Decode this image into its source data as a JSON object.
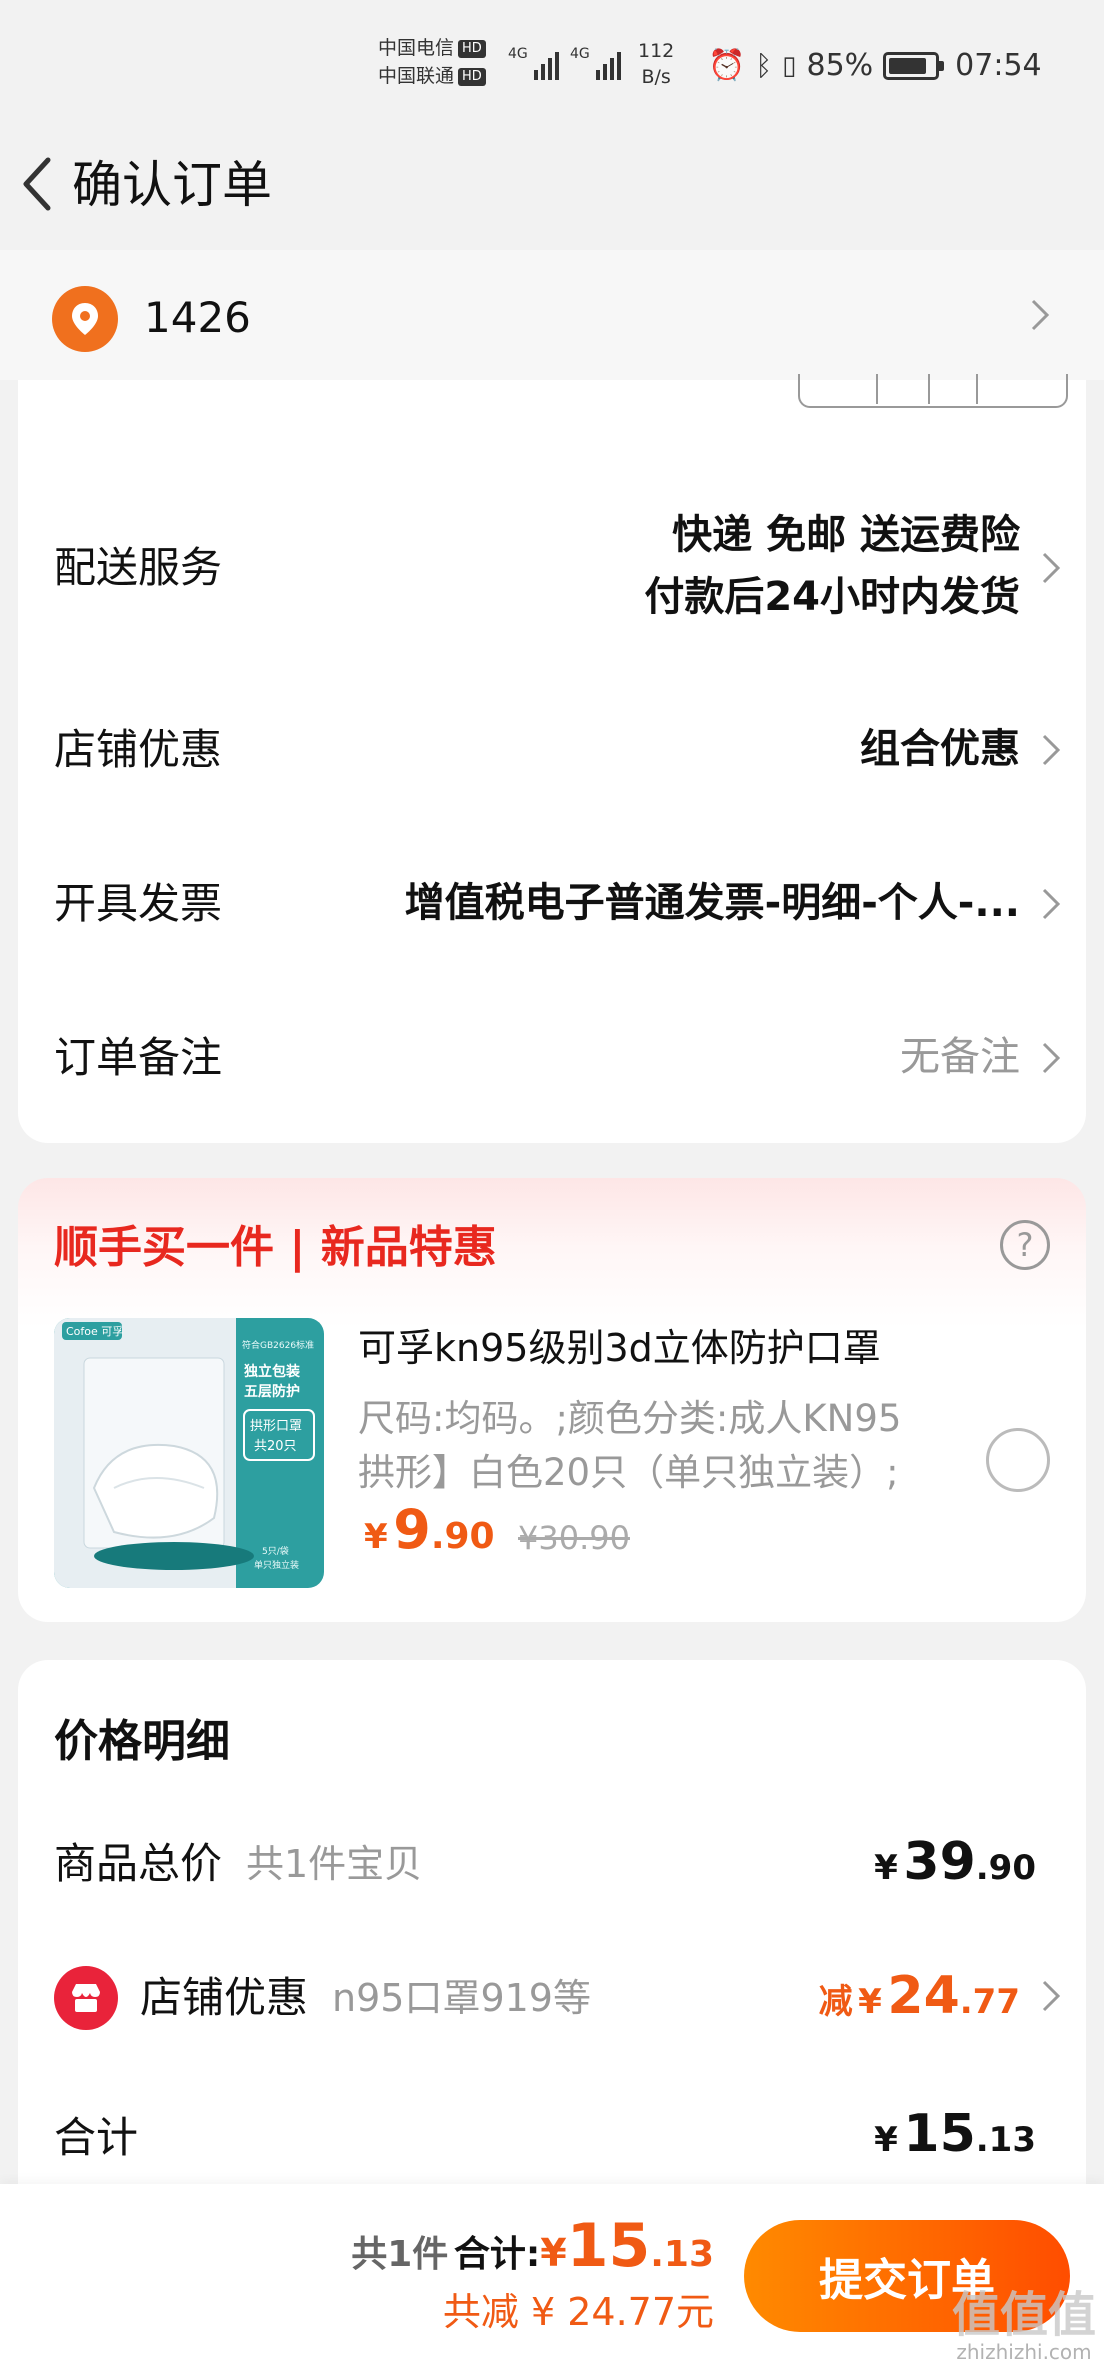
{
  "status_bar": {
    "carrier1": "中国电信",
    "carrier2": "中国联通",
    "hd_badge": "HD",
    "network1": "4G",
    "network2": "4G",
    "speed_value": "112",
    "speed_unit": "B/s",
    "battery_percent": "85%",
    "battery_level": 0.85,
    "time": "07:54"
  },
  "nav": {
    "title": "确认订单"
  },
  "address": {
    "text": "1426"
  },
  "order_options": [
    {
      "label": "配送服务",
      "value_line1": "快递 免邮 送运费险",
      "value_line2": "付款后24小时内发货"
    },
    {
      "label": "店铺优惠",
      "value": "组合优惠"
    },
    {
      "label": "开具发票",
      "value": "增值税电子普通发票-明细-个人-..."
    },
    {
      "label": "订单备注",
      "value": "无备注"
    }
  ],
  "upsell": {
    "title": "顺手买一件 | 新品特惠",
    "product_name": "可孚kn95级别3d立体防护口罩",
    "spec_line1": "尺码:均码。;颜色分类:成人KN95",
    "spec_line2": "拱形】白色20只（单只独立装）;",
    "price_yen": "¥",
    "price_int": "9",
    "price_dec": ".90",
    "original_price": "¥30.90",
    "img_brand": "Cofoe 可孚",
    "img_std": "符合GB2626标准",
    "img_pkg1": "独立包装",
    "img_pkg2": "五层防护",
    "img_shape1": "拱形口罩",
    "img_shape2": "共20只",
    "img_pack": "5只/袋",
    "img_pack2": "单只独立装"
  },
  "price_detail": {
    "title": "价格明细",
    "goods_label": "商品总价",
    "goods_sub": "共1件宝贝",
    "goods_yen": "¥",
    "goods_int": "39",
    "goods_dec": ".90",
    "shop_label": "店铺优惠",
    "shop_sub": "n95口罩919等",
    "shop_prefix": "减",
    "shop_yen": "¥",
    "shop_int": "24",
    "shop_dec": ".77",
    "total_label": "合计",
    "total_yen": "¥",
    "total_int": "15",
    "total_dec": ".13"
  },
  "bottom_bar": {
    "count": "共1件",
    "total_label": "合计:",
    "total_yen": "¥",
    "total_int": "15",
    "total_dec": ".13",
    "discount": "共减 ¥ 24.77元",
    "submit_label": "提交订单"
  },
  "watermark": {
    "big": "值值值",
    "small": "zhizhizhi.com"
  },
  "colors": {
    "accent_orange": "#f05a14",
    "promo_red": "#e8281f",
    "pin_orange": "#f0701e",
    "shop_red": "#e9233a"
  }
}
